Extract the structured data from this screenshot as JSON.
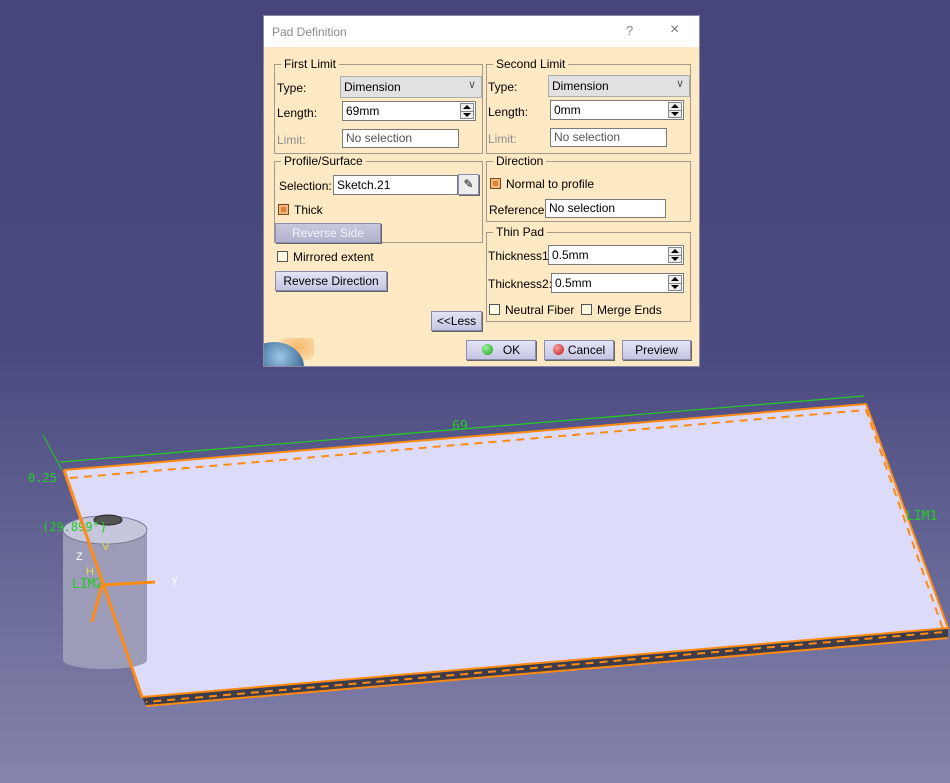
{
  "dialog": {
    "title": "Pad Definition",
    "help_label": "?",
    "close_label": "×",
    "first_limit": {
      "legend": "First Limit",
      "type_label": "Type:",
      "type_value": "Dimension",
      "length_label": "Length:",
      "length_value": "69mm",
      "limit_label": "Limit:",
      "limit_value": "No selection"
    },
    "second_limit": {
      "legend": "Second Limit",
      "type_label": "Type:",
      "type_value": "Dimension",
      "length_label": "Length:",
      "length_value": "0mm",
      "limit_label": "Limit:",
      "limit_value": "No selection"
    },
    "profile": {
      "legend": "Profile/Surface",
      "selection_label": "Selection:",
      "selection_value": "Sketch.21",
      "thick_label": "Thick",
      "thick_checked": true,
      "reverse_side_label": "Reverse Side"
    },
    "direction": {
      "legend": "Direction",
      "normal_label": "Normal to profile",
      "normal_checked": true,
      "reference_label": "Reference:",
      "reference_value": "No selection"
    },
    "thin_pad": {
      "legend": "Thin Pad",
      "thickness1_label": "Thickness1",
      "thickness1_value": "0.5mm",
      "thickness2_label": "Thickness2:",
      "thickness2_value": "0.5mm",
      "neutral_label": "Neutral Fiber",
      "neutral_checked": false,
      "merge_label": "Merge Ends",
      "merge_checked": false
    },
    "mirrored_label": "Mirrored extent",
    "mirrored_checked": false,
    "reverse_direction_label": "Reverse Direction",
    "less_label": "<<Less",
    "ok_label": "OK",
    "cancel_label": "Cancel",
    "preview_label": "Preview"
  },
  "viewport": {
    "dimension_length": "69",
    "dimension_small": "0.25",
    "angle_label": "(29.899°)",
    "lim1_label": "LIM1",
    "lim2_label": "LIM2",
    "axis_z": "Z",
    "axis_h": "H",
    "axis_v": "V",
    "axis_y": "y",
    "colors": {
      "background_top": "#46467a",
      "background_bottom": "#8484ac",
      "plate": "#dcdcfa",
      "highlight": "#ff8a14",
      "dimension": "#22cc22"
    }
  }
}
